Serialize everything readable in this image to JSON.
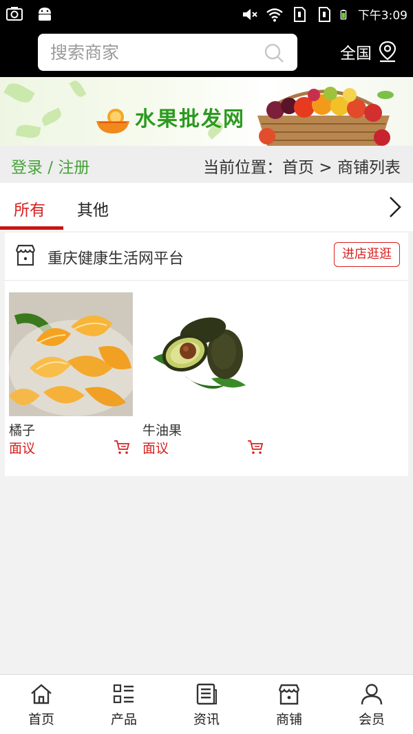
{
  "status_bar": {
    "time": "下午3:09",
    "icons": [
      "camera-icon",
      "android-icon",
      "mute-icon",
      "wifi-icon",
      "sim1-icon",
      "sim2-icon",
      "battery-icon"
    ]
  },
  "header": {
    "search_placeholder": "搜索商家",
    "region_label": "全国"
  },
  "banner": {
    "title": "水果批发网"
  },
  "navline": {
    "login_label": "登录 / 注册",
    "breadcrumb": "当前位置：首页 > 商铺列表"
  },
  "tabs": [
    {
      "label": "所有",
      "active": true
    },
    {
      "label": "其他",
      "active": false
    }
  ],
  "shop": {
    "name": "重庆健康生活网平台",
    "visit_label": "进店逛逛",
    "products": [
      {
        "name": "橘子",
        "price": "面议"
      },
      {
        "name": "牛油果",
        "price": "面议"
      }
    ]
  },
  "bottom_nav": [
    {
      "label": "首页",
      "icon": "home-icon"
    },
    {
      "label": "产品",
      "icon": "grid-list-icon"
    },
    {
      "label": "资讯",
      "icon": "news-icon"
    },
    {
      "label": "商铺",
      "icon": "shop-icon"
    },
    {
      "label": "会员",
      "icon": "user-icon"
    }
  ],
  "colors": {
    "accent_red": "#d81e1e",
    "login_green": "#48a339",
    "banner_green": "#2b9a1f"
  }
}
